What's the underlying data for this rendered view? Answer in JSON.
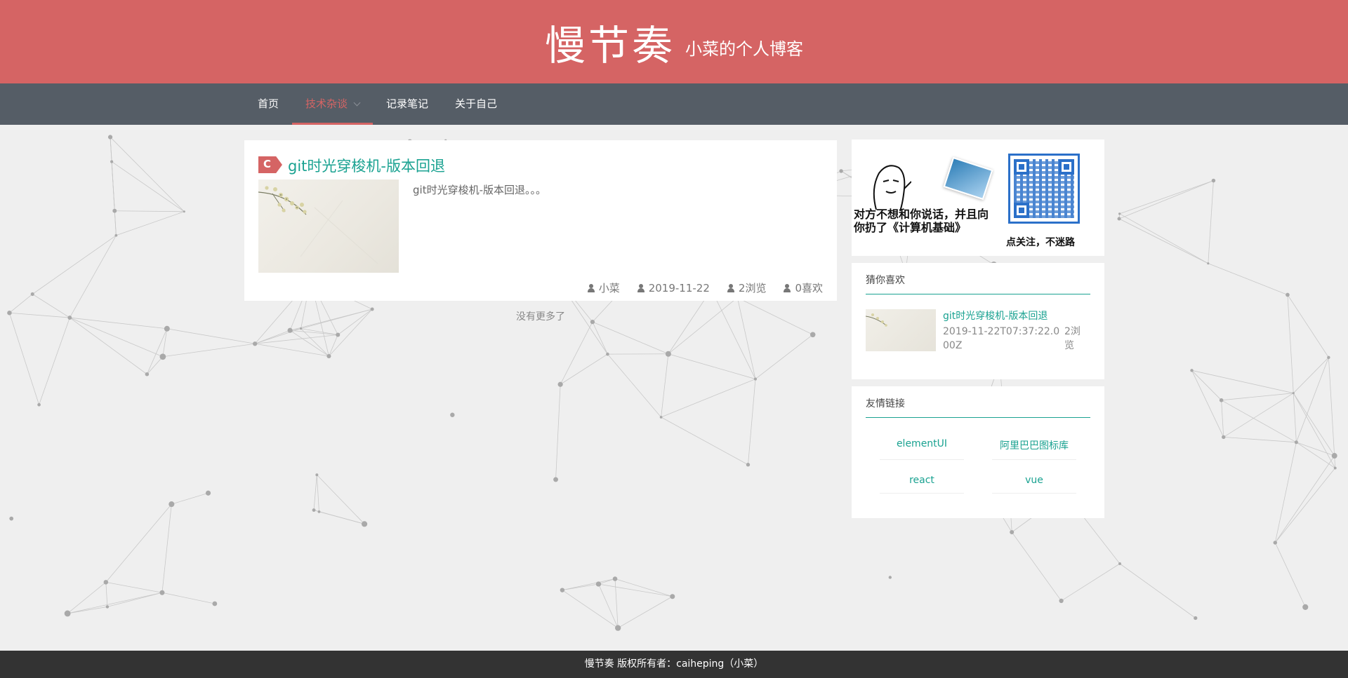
{
  "header": {
    "title": "慢节奏",
    "subtitle": "小菜的个人博客"
  },
  "nav": {
    "items": [
      "首页",
      "技术杂谈",
      "记录笔记",
      "关于自己"
    ],
    "active_index": 1
  },
  "post": {
    "badge": "C",
    "title": "git时光穿梭机-版本回退",
    "excerpt": "git时光穿梭机-版本回退。。。",
    "author": "小菜",
    "date": "2019-11-22",
    "views": "2浏览",
    "likes": "0喜欢"
  },
  "no_more": "没有更多了",
  "ad": {
    "text_left": "对方不想和你说话，并且向你扔了《计算机基础》",
    "text_right": "点关注，不迷路"
  },
  "guess_like": {
    "title": "猜你喜欢",
    "item_title": "git时光穿梭机-版本回退",
    "item_date": "2019-11-22T07:37:22.000Z",
    "item_views": "2浏览"
  },
  "friend_links": {
    "title": "友情链接",
    "items": [
      "elementUI",
      "阿里巴巴图标库",
      "react",
      "vue"
    ]
  },
  "footer": {
    "text": "慢节奏 版权所有者：caiheping（小菜）"
  },
  "colors": {
    "brand": "#d56464",
    "nav_bg": "#555d66",
    "link": "#1aa291",
    "footer_bg": "#333333"
  }
}
